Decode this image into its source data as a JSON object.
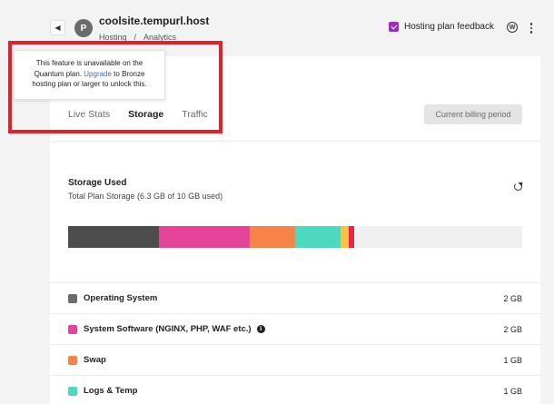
{
  "header": {
    "back_icon": "chevron-left-icon",
    "avatar_letter": "P",
    "site_name": "coolsite.tempurl.host",
    "breadcrumb": [
      "Hosting",
      "/",
      "Analytics"
    ],
    "feedback_label": "Hosting plan feedback",
    "feedback_icon": "feedback-icon",
    "wp_icon": "wordpress-icon",
    "more_icon": "more-vertical-icon"
  },
  "tooltip": {
    "before": "This feature is unavailable on the Quantum plan. ",
    "link": "Upgrade",
    "after": " to Bronze hosting plan or larger to unlock this."
  },
  "tabs": [
    {
      "label": "Live Stats",
      "active": false
    },
    {
      "label": "Storage",
      "active": true
    },
    {
      "label": "Traffic",
      "active": false
    }
  ],
  "billing_button": "Current billing period",
  "storage": {
    "title": "Storage Used",
    "subtitle": "Total Plan Storage (6.3 GB of 10 GB used)",
    "refresh_icon": "refresh-icon",
    "used_gb": 6.3,
    "total_gb": 10,
    "segments": [
      {
        "name": "Operating System",
        "gb": 2,
        "color": "#4d4d4d"
      },
      {
        "name": "System Software",
        "gb": 2,
        "color": "#e6449a"
      },
      {
        "name": "Swap",
        "gb": 1,
        "color": "#f5834a"
      },
      {
        "name": "Logs & Temp",
        "gb": 1,
        "color": "#4dd9c0"
      },
      {
        "name": "yellow",
        "gb": 0.17,
        "color": "#f5c542"
      },
      {
        "name": "red",
        "gb": 0.13,
        "color": "#e8283c"
      }
    ]
  },
  "rows": [
    {
      "label": "Operating System",
      "value": "2 GB",
      "color": "#6b6b6b",
      "info": false
    },
    {
      "label": "System Software (NGINX, PHP, WAF etc.)",
      "value": "2 GB",
      "color": "#e6449a",
      "info": true
    },
    {
      "label": "Swap",
      "value": "1 GB",
      "color": "#f5834a",
      "info": false
    },
    {
      "label": "Logs & Temp",
      "value": "1 GB",
      "color": "#4dd9c0",
      "info": false
    }
  ]
}
